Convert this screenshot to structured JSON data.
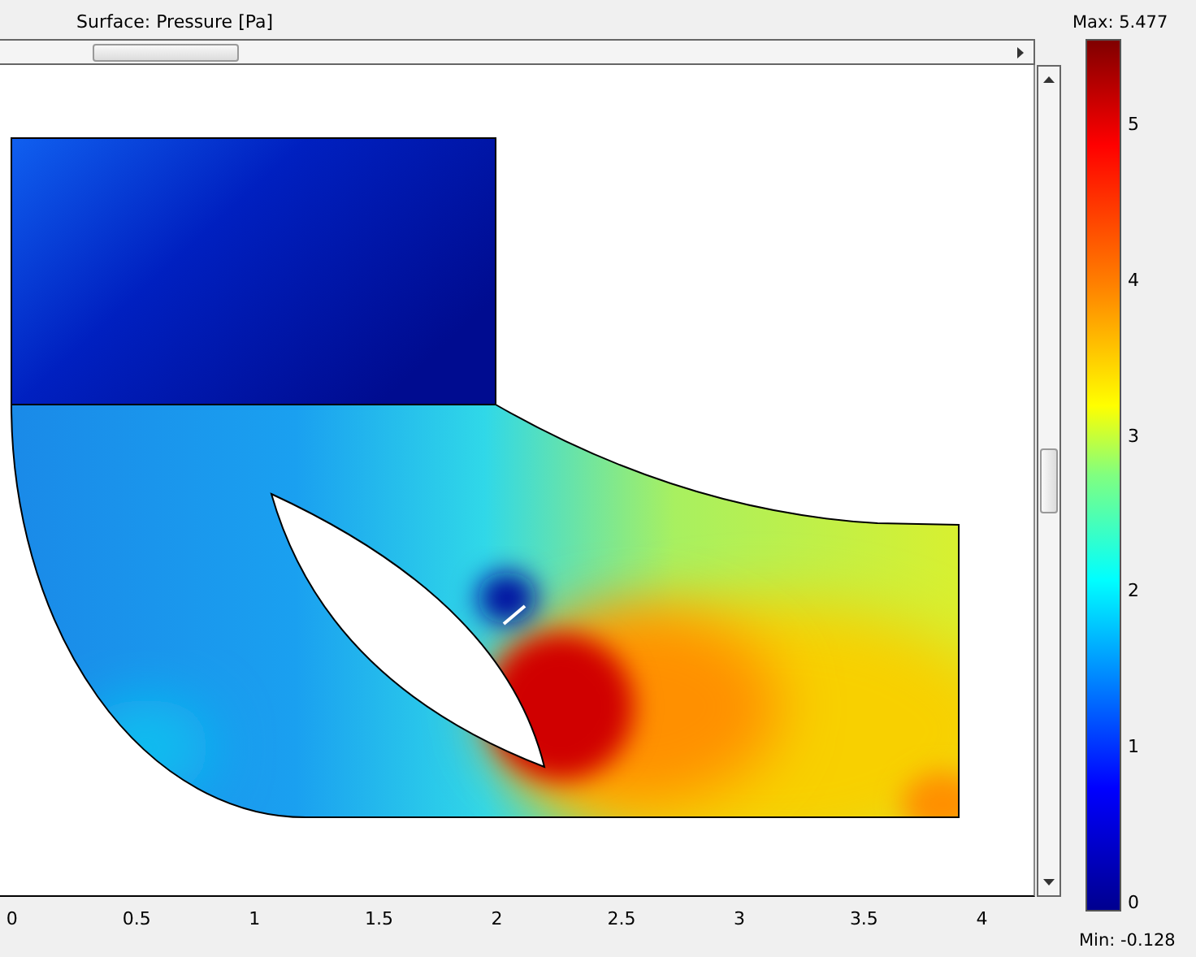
{
  "plot_title": "Surface: Pressure [Pa]",
  "color_legend": {
    "max_label": "Max: 5.477",
    "min_label": "Min: -0.128",
    "ticks": [
      "5",
      "4",
      "3",
      "2",
      "1",
      "0"
    ]
  },
  "x_axis": {
    "ticks": [
      "0",
      "0.5",
      "1",
      "1.5",
      "2",
      "2.5",
      "3",
      "3.5",
      "4"
    ]
  }
}
